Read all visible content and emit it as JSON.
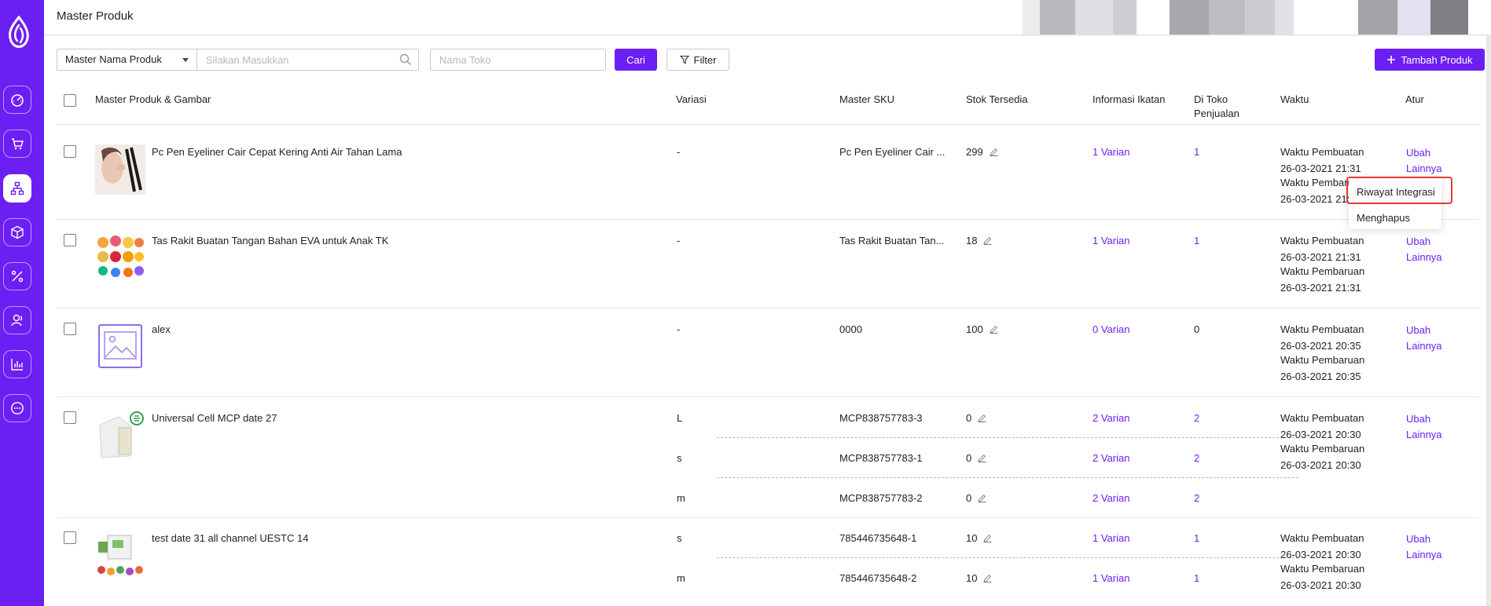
{
  "header": {
    "title": "Master Produk"
  },
  "toolbar": {
    "search_type": "Master Nama Produk",
    "search_placeholder": "Silakan Masukkan",
    "shop_placeholder": "Nama Toko",
    "search_button": "Cari",
    "filter_button": "Filter",
    "add_button": "Tambah Produk"
  },
  "table": {
    "columns": [
      "Master Produk & Gambar",
      "Variasi",
      "Master SKU",
      "Stok Tersedia",
      "Informasi Ikatan",
      "Di Toko Penjualan",
      "Waktu",
      "Atur"
    ],
    "created_label": "Waktu Pembuatan",
    "updated_label": "Waktu Pembaruan",
    "edit_label": "Ubah",
    "more_label": "Lainnya",
    "rows": [
      {
        "name": "Pc Pen Eyeliner Cair Cepat Kering Anti Air Tahan Lama",
        "variants": [
          {
            "variation": "-",
            "sku": "Pc Pen Eyeliner Cair ...",
            "stock": "299",
            "binding": "1 Varian",
            "stores": "1"
          }
        ],
        "created": "26-03-2021 21:31",
        "updated": "26-03-2021 21:31"
      },
      {
        "name": "Tas Rakit Buatan Tangan Bahan EVA untuk Anak TK",
        "variants": [
          {
            "variation": "-",
            "sku": "Tas Rakit Buatan Tan...",
            "stock": "18",
            "binding": "1 Varian",
            "stores": "1"
          }
        ],
        "created": "26-03-2021 21:31",
        "updated": "26-03-2021 21:31"
      },
      {
        "name": "alex",
        "variants": [
          {
            "variation": "-",
            "sku": "0000",
            "stock": "100",
            "binding": "0 Varian",
            "stores": "0"
          }
        ],
        "created": "26-03-2021 20:35",
        "updated": "26-03-2021 20:35"
      },
      {
        "name": "Universal Cell MCP date 27",
        "variants": [
          {
            "variation": "L",
            "sku": "MCP838757783-3",
            "stock": "0",
            "binding": "2 Varian",
            "stores": "2"
          },
          {
            "variation": "s",
            "sku": "MCP838757783-1",
            "stock": "0",
            "binding": "2 Varian",
            "stores": "2"
          },
          {
            "variation": "m",
            "sku": "MCP838757783-2",
            "stock": "0",
            "binding": "2 Varian",
            "stores": "2"
          }
        ],
        "created": "26-03-2021 20:30",
        "updated": "26-03-2021 20:30"
      },
      {
        "name": "test date 31 all channel UESTC 14",
        "variants": [
          {
            "variation": "s",
            "sku": "785446735648-1",
            "stock": "10",
            "binding": "1 Varian",
            "stores": "1"
          },
          {
            "variation": "m",
            "sku": "785446735648-2",
            "stock": "10",
            "binding": "1 Varian",
            "stores": "1"
          }
        ],
        "created": "26-03-2021 20:30",
        "updated": "26-03-2021 20:30"
      }
    ]
  },
  "more_menu": {
    "items": [
      "Riwayat Integrasi",
      "Menghapus"
    ]
  },
  "nav_icons": [
    "dashboard-icon",
    "cart-icon",
    "hierarchy-icon",
    "box-icon",
    "percent-icon",
    "customers-icon",
    "chart-icon",
    "chat-icon"
  ],
  "colors": {
    "brand": "#6c1ff2",
    "highlight": "#e53935"
  }
}
